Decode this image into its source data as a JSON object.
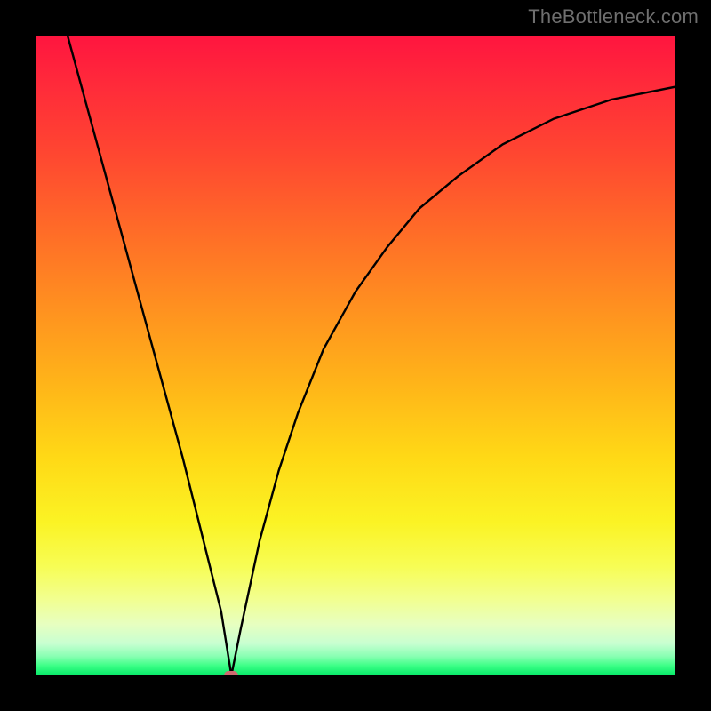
{
  "watermark": "TheBottleneck.com",
  "chart_data": {
    "type": "line",
    "title": "",
    "xlabel": "",
    "ylabel": "",
    "xlim": [
      0,
      100
    ],
    "ylim": [
      0,
      100
    ],
    "grid": false,
    "series": [
      {
        "name": "bottleneck-curve",
        "x": [
          5,
          8,
          11,
          14,
          17,
          20,
          23,
          26,
          29,
          30.6,
          32,
          35,
          38,
          41,
          45,
          50,
          55,
          60,
          66,
          73,
          81,
          90,
          100
        ],
        "y": [
          100,
          89,
          78,
          67,
          56,
          45,
          34,
          22,
          10,
          0,
          7,
          21,
          32,
          41,
          51,
          60,
          67,
          73,
          78,
          83,
          87,
          90,
          92
        ]
      }
    ],
    "marker": {
      "x": 30.6,
      "y": 0,
      "color": "#cf6a70"
    },
    "background_gradient": {
      "stops": [
        {
          "pos": 0.0,
          "color": "#ff153f"
        },
        {
          "pos": 0.5,
          "color": "#ffb319"
        },
        {
          "pos": 0.8,
          "color": "#f7fd55"
        },
        {
          "pos": 1.0,
          "color": "#06e968"
        }
      ],
      "direction": "top-to-bottom"
    }
  }
}
